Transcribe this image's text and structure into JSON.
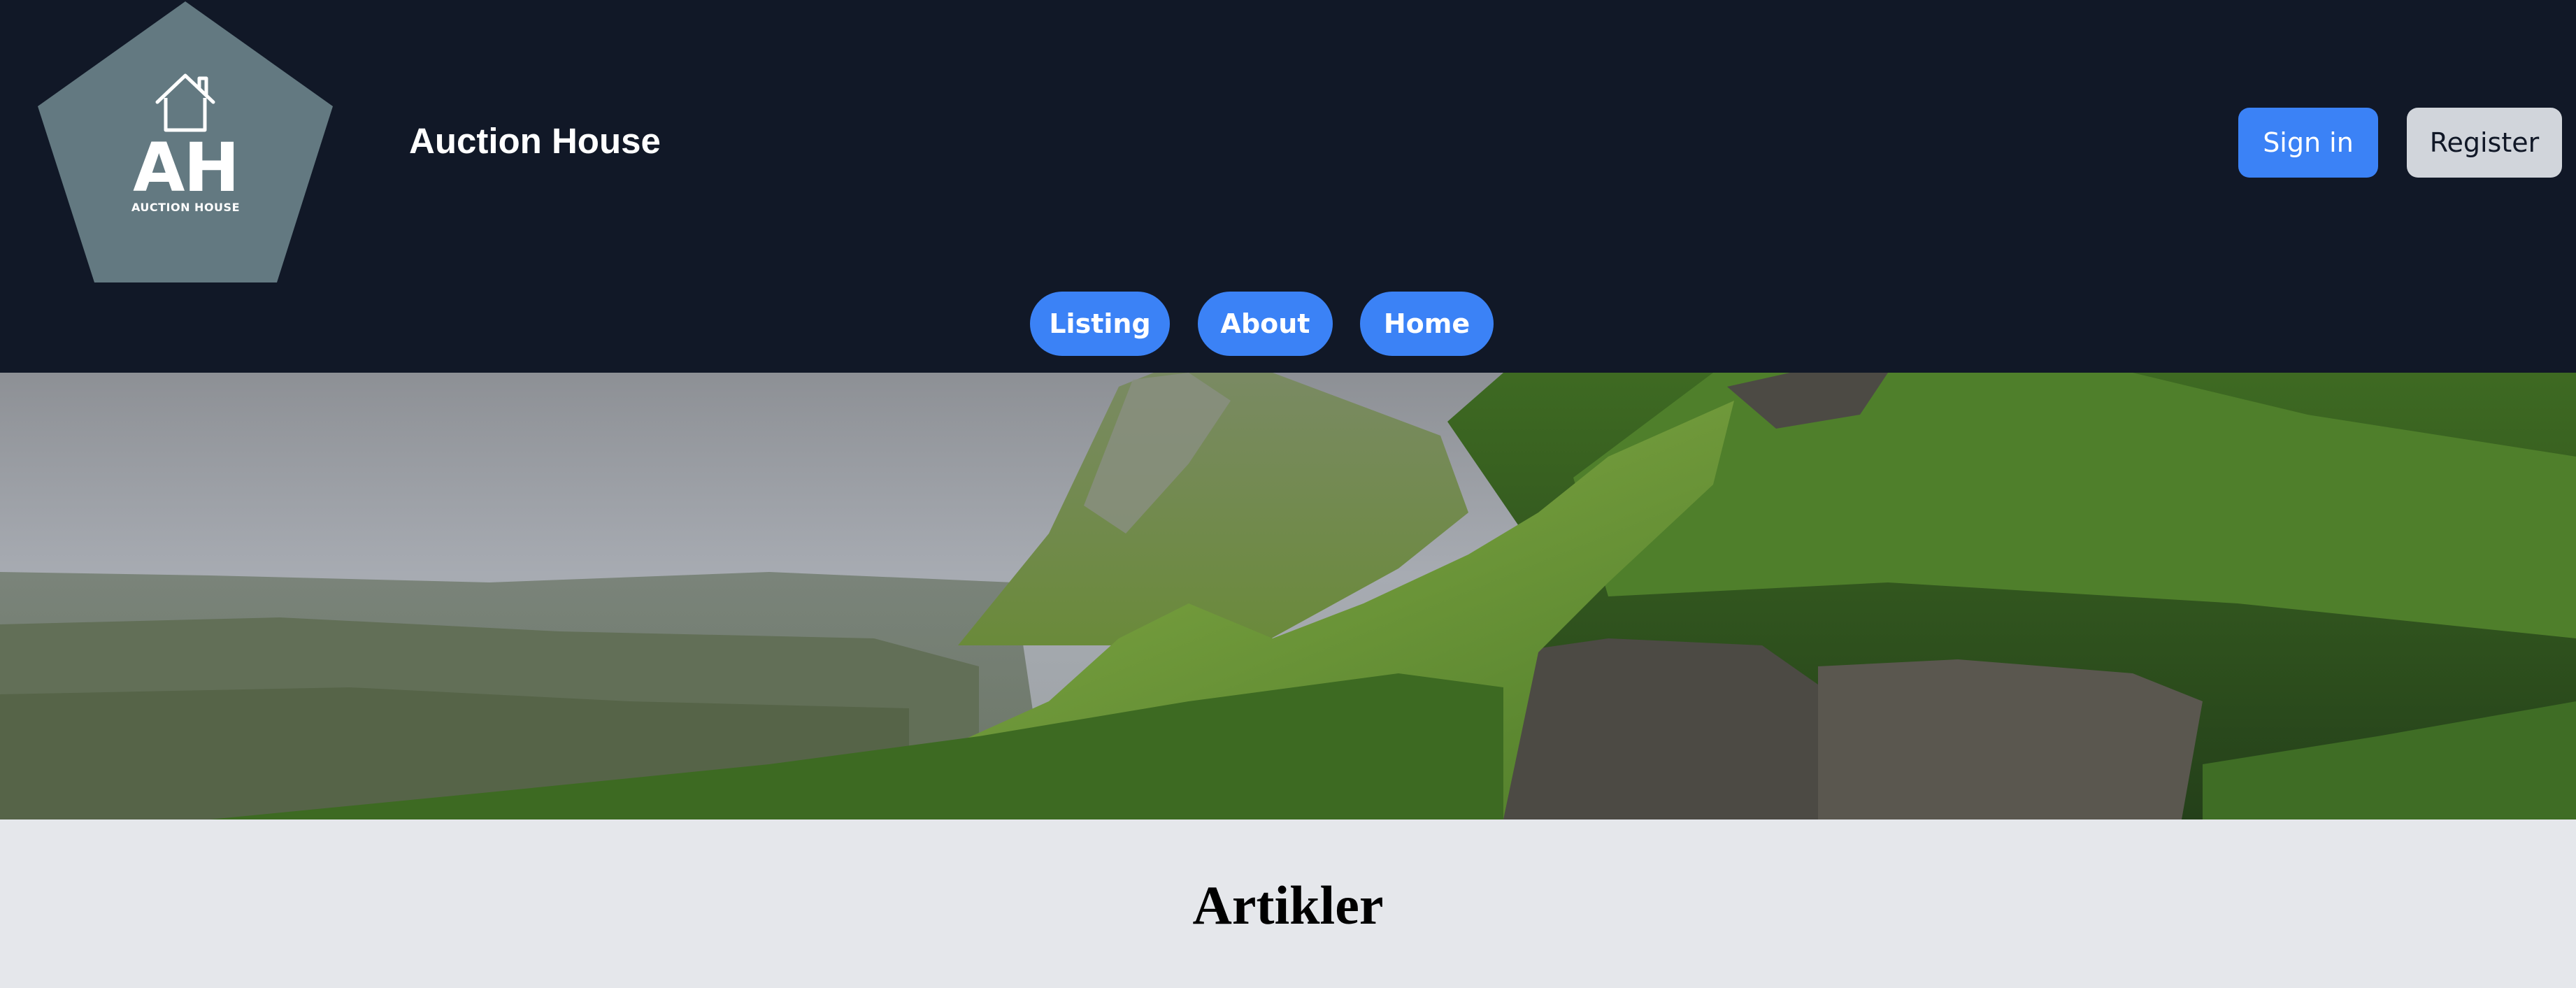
{
  "header": {
    "logo": {
      "monogram": "AH",
      "caption": "AUCTION HOUSE",
      "icon": "house-icon",
      "background_color": "#637981"
    },
    "site_title": "Auction House",
    "auth": {
      "sign_in_label": "Sign in",
      "register_label": "Register"
    },
    "nav": [
      {
        "label": "Listing"
      },
      {
        "label": "About"
      },
      {
        "label": "Home"
      }
    ]
  },
  "hero": {
    "image": "green-mountain-landscape"
  },
  "main": {
    "heading": "Artikler"
  },
  "colors": {
    "header_background": "#111827",
    "accent": "#3b82f6",
    "secondary_button": "#d1d5db",
    "page_background": "#e5e7eb"
  }
}
